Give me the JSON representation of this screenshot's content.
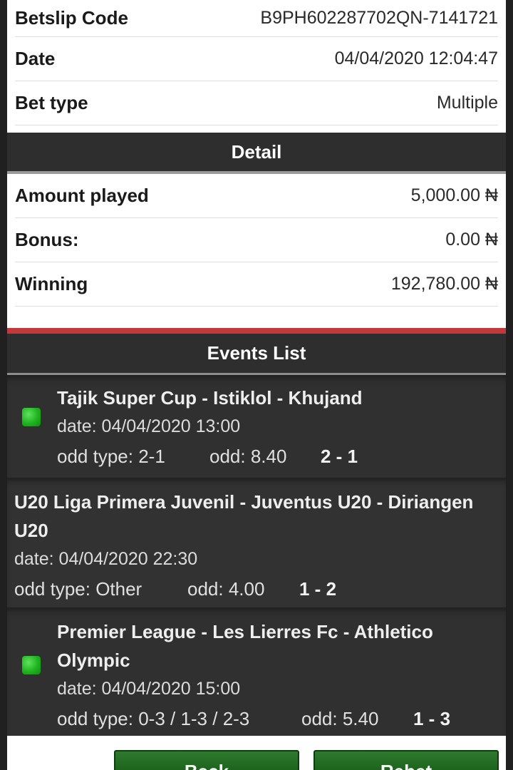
{
  "summary": {
    "betslip_code_label": "Betslip Code",
    "betslip_code_value": "B9PH602287702QN-7141721",
    "date_label": "Date",
    "date_value": "04/04/2020 12:04:47",
    "bet_type_label": "Bet type",
    "bet_type_value": "Multiple"
  },
  "detail": {
    "header": "Detail",
    "amount_played_label": "Amount played",
    "amount_played_value": "5,000.00 ₦",
    "bonus_label": "Bonus:",
    "bonus_value": "0.00 ₦",
    "winning_label": "Winning",
    "winning_value": "192,780.00 ₦"
  },
  "events": {
    "header": "Events List",
    "items": [
      {
        "title": "Tajik Super Cup - Istiklol - Khujand",
        "date": "date: 04/04/2020 13:00",
        "odd_type": "odd type: 2-1",
        "odd": "odd: 8.40",
        "score": "2 - 1",
        "status_icon": "green-square",
        "status_color": "#2fbf2f"
      },
      {
        "title_line1": "U20 Liga Primera Juvenil - Juventus U20 - Diriangen",
        "title_line2": "U20",
        "date": "date: 04/04/2020 22:30",
        "odd_type": "odd type: Other",
        "odd": "odd: 4.00",
        "score": "1 - 2"
      },
      {
        "title_line1": "Premier League - Les Lierres Fc - Athletico",
        "title_line2": "Olympic",
        "date": "date: 04/04/2020 15:00",
        "odd_type": "odd type: 0-3 / 1-3 / 2-3",
        "odd": "odd: 5.40",
        "score": "1 - 3",
        "status_icon": "green-square",
        "status_color": "#2fbf2f"
      }
    ]
  },
  "buttons": {
    "back_label": "Back",
    "rebet_label": "Rebet"
  },
  "colors": {
    "header_bg": "#2e2e2e",
    "accent_red": "#c0393b",
    "button_green": "#236b23"
  }
}
